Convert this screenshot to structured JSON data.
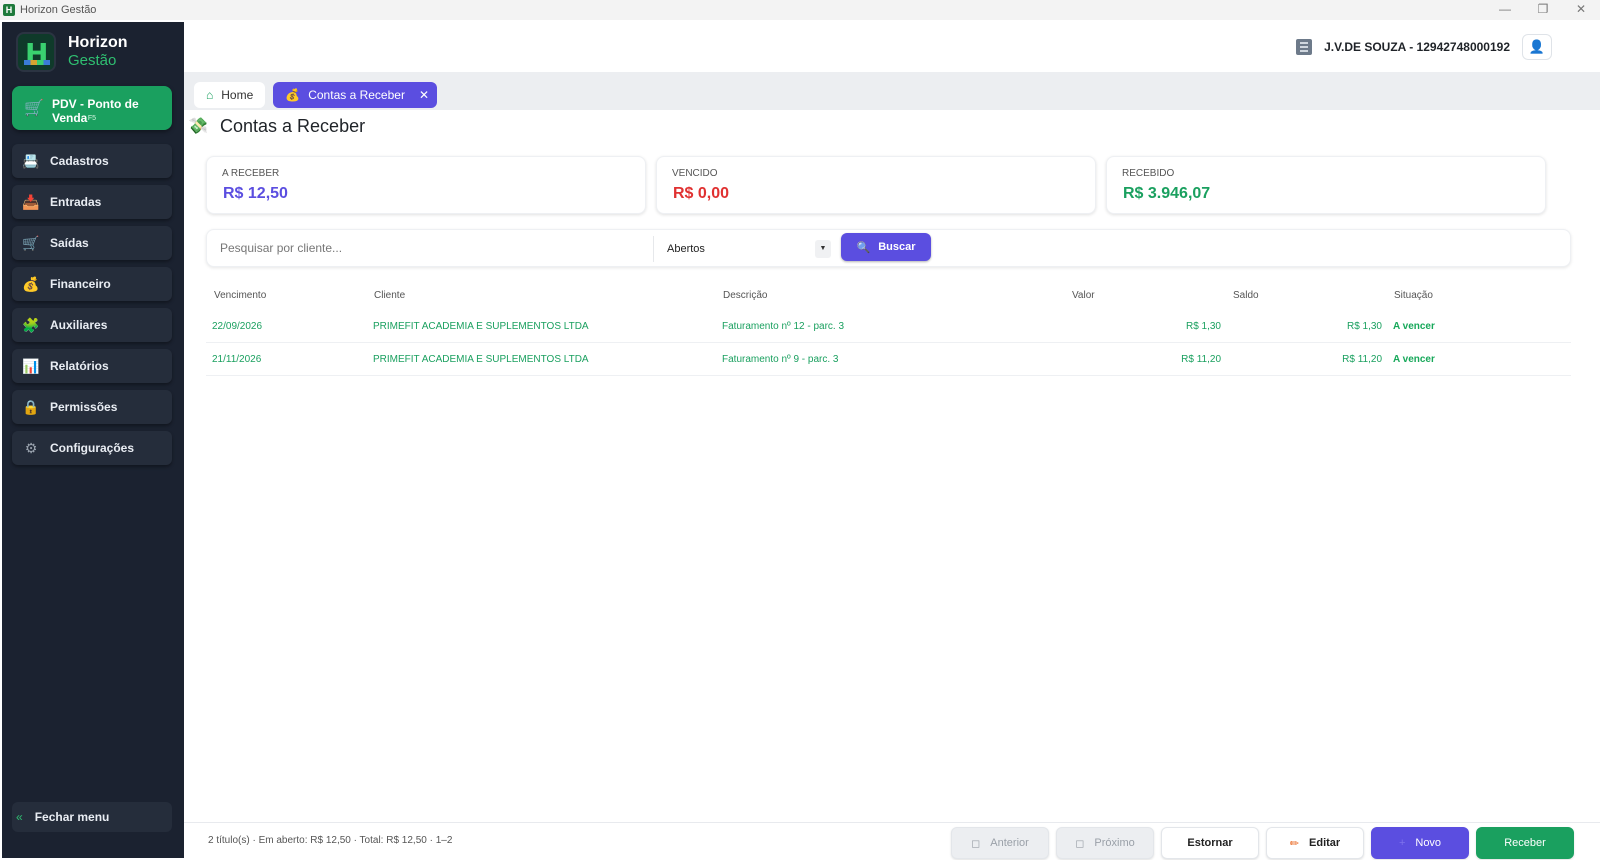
{
  "window": {
    "title": "Horizon Gestão",
    "controls": [
      "—",
      "❐",
      "✕"
    ]
  },
  "brand": {
    "name": "Horizon",
    "sub": "Gestão"
  },
  "pdv": {
    "label": "PDV - Ponto de Venda",
    "shortcut": "F5"
  },
  "sidebar": {
    "items": [
      {
        "label": "Cadastros",
        "icon": "📇"
      },
      {
        "label": "Entradas",
        "icon": "📥"
      },
      {
        "label": "Saídas",
        "icon": "🛒"
      },
      {
        "label": "Financeiro",
        "icon": "💰"
      },
      {
        "label": "Auxiliares",
        "icon": "🧩"
      },
      {
        "label": "Relatórios",
        "icon": "📊"
      },
      {
        "label": "Permissões",
        "icon": "🔒"
      },
      {
        "label": "Configurações",
        "icon": "⚙"
      }
    ],
    "close_menu": "Fechar menu"
  },
  "header": {
    "company": "J.V.DE SOUZA - 12942748000192"
  },
  "tabs": {
    "home": "Home",
    "active": "Contas a Receber"
  },
  "page": {
    "title": "Contas a Receber"
  },
  "summary": {
    "a_receber": {
      "label": "A RECEBER",
      "value": "R$ 12,50",
      "color": "#5b4ee0"
    },
    "vencido": {
      "label": "VENCIDO",
      "value": "R$ 0,00",
      "color": "#e03131"
    },
    "recebido": {
      "label": "RECEBIDO",
      "value": "R$ 3.946,07",
      "color": "#1aa05f"
    }
  },
  "search": {
    "placeholder": "Pesquisar por cliente...",
    "filter": "Abertos",
    "button": "Buscar"
  },
  "table": {
    "columns": [
      "Vencimento",
      "Cliente",
      "Descrição",
      "Valor",
      "Saldo",
      "Situação"
    ],
    "rows": [
      {
        "vencimento": "22/09/2026",
        "cliente": "PRIMEFIT ACADEMIA E SUPLEMENTOS LTDA",
        "descricao": "Faturamento nº 12 - parc. 3",
        "valor": "R$ 1,30",
        "saldo": "R$ 1,30",
        "situacao": "A vencer"
      },
      {
        "vencimento": "21/11/2026",
        "cliente": "PRIMEFIT ACADEMIA E SUPLEMENTOS LTDA",
        "descricao": "Faturamento nº 9 - parc. 3",
        "valor": "R$ 11,20",
        "saldo": "R$ 11,20",
        "situacao": "A vencer"
      }
    ]
  },
  "footer": {
    "info": "2 título(s)  ·  Em aberto: R$ 12,50  ·  Total: R$ 12,50  ·  1–2",
    "buttons": {
      "anterior": "Anterior",
      "proximo": "Próximo",
      "estornar": "Estornar",
      "editar": "Editar",
      "novo": "Novo",
      "receber": "Receber"
    }
  },
  "colors": {
    "sidebar": "#1b2230",
    "accent_green": "#1aa05f",
    "accent_purple": "#5b4ee0"
  }
}
